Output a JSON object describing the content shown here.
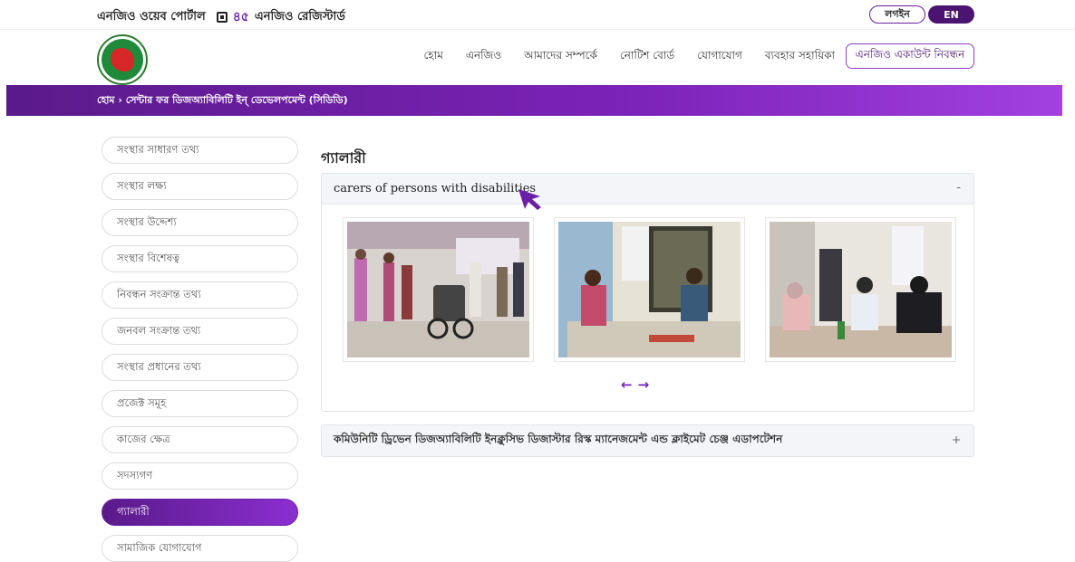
{
  "topbar": {
    "portal_name": "এনজিও ওয়েব পোর্টাল",
    "registered_count": "৪৫",
    "registered_label": "এনজিও রেজিস্টার্ড",
    "login_label": "লগইন",
    "lang_label": "EN"
  },
  "nav": {
    "items": [
      "হোম",
      "এনজিও",
      "আমাদের সম্পর্কে",
      "নোটিশ বোর্ড",
      "যোগাযোগ",
      "ব্যবহার সহায়িকা"
    ],
    "register_label": "এনজিও একাউন্ট নিবন্ধন"
  },
  "breadcrumb": {
    "text": "হোম › সেন্টার ফর ডিজঅ্যাবিলিটি ইন্ ডেভেলপমেন্ট (সিডিডি)"
  },
  "sidebar": {
    "items": [
      {
        "label": "সংস্থার সাধারণ তথ্য"
      },
      {
        "label": "সংস্থার লক্ষ্য"
      },
      {
        "label": "সংস্থার উদ্দেশ্য"
      },
      {
        "label": "সংস্থার বিশেষত্ব"
      },
      {
        "label": "নিবন্ধন সংক্রান্ত তথ্য"
      },
      {
        "label": "জনবল সংক্রান্ত তথ্য"
      },
      {
        "label": "সংস্থার প্রধানের তথ্য"
      },
      {
        "label": "প্রজেক্ট সমূহ"
      },
      {
        "label": "কাজের ক্ষেত্র"
      },
      {
        "label": "সদস্যগণ"
      },
      {
        "label": "গ্যালারী"
      },
      {
        "label": "সামাজিক যোগাযোগ"
      }
    ]
  },
  "main": {
    "title": "গ্যালারী",
    "panels": [
      {
        "title": "carers of persons with disabilities",
        "toggle": "-"
      },
      {
        "title": "কমিউনিটি ড্রিভেন ডিজঅ্যাবিলিটি ইনক্লুসিভ ডিজাস্টার রিস্ক ম্যানেজমেন্ট এন্ড ক্লাইমেট চেঞ্জ এডাপটেশন",
        "toggle": "+"
      }
    ],
    "carousel_prev": "←",
    "carousel_next": "→"
  },
  "colors": {
    "brand_purple": "#6b1fa6",
    "band_purple": "#7c23b9",
    "logo_green": "#1f8a3a",
    "logo_red": "#d62828"
  }
}
